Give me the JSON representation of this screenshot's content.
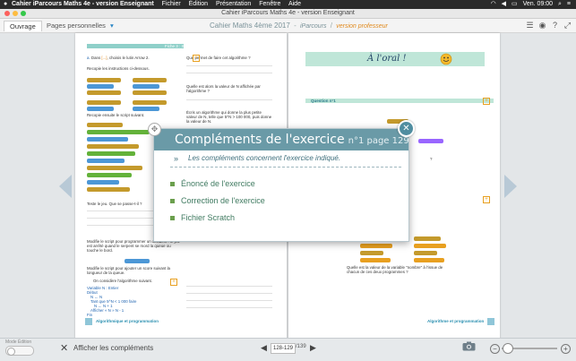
{
  "menubar": {
    "app_name": "Cahier iParcours Maths 4e - version Enseignant",
    "menus": [
      "Fichier",
      "Édition",
      "Présentation",
      "Fenêtre",
      "Aide"
    ],
    "clock": "Ven. 09:00"
  },
  "window": {
    "title": "Cahier iParcours Maths 4e - version Enseignant"
  },
  "toolbar": {
    "tab_ouvrage": "Ouvrage",
    "tab_pages_perso": "Pages personnelles",
    "doc_title": "Cahier Maths 4ème 2017",
    "doc_sub": "iParcours",
    "doc_version": "version professeur"
  },
  "left_page": {
    "header": "Fiche 3 : Scratch",
    "q1_text": "Que permet de faire cet algorithme ?",
    "q3_text": "Quelle est alors la valeur de N affichée par l'algorithme ?",
    "q4_text": "Écris un algorithme qui donne la plus petite valeur de N, telle que 5^N > 100 000, puis donne la valeur de N.",
    "b_text": "Recopie ensuite le script suivant.",
    "c_text": "Teste le jeu. Que se passe-t-il ?",
    "d_text": "Modifie le script pour programmer un accident : le jeu est arrêté quand le serpent se mord la queue ou touche le bord.",
    "e_text": "Modifie le script pour ajouter un score suivant la longueur de la queue.",
    "alg_title": "On considère l'algorithme suivant.",
    "footer": "Algorithmique et programmation",
    "page_num": "128"
  },
  "right_page": {
    "oral_title": "À l'oral !",
    "question_label": "Question n°1",
    "footer": "Algorithme et programmation",
    "q_bottom": "Quelle est la valeur de la variable \"nombre\" à l'issue de chacun de ces deux programmes ?",
    "page_num": "129"
  },
  "dialog": {
    "title": "Compléments de l'exercice",
    "title_suffix": "n°1 page 129",
    "subtitle": "Les compléments concernent l'exercice indiqué.",
    "items": [
      "Énoncé de l'exercice",
      "Correction de l'exercice",
      "Fichier Scratch"
    ]
  },
  "bottombar": {
    "mode_label": "Mode Édition",
    "show_complements": "Afficher les compléments",
    "page_input": "128-129",
    "page_total": "/139"
  },
  "colors": {
    "dialog_header": "#6a9aa7",
    "item_text": "#3f7a60",
    "item_bullet": "#6b9f4d",
    "accent_orange": "#e08a1e"
  }
}
